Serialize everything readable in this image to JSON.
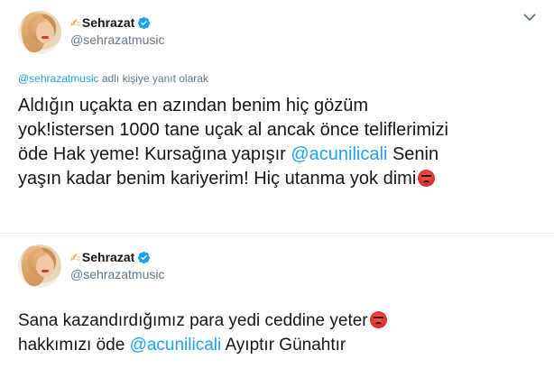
{
  "tweet1": {
    "display_name": "Sehrazat",
    "handle": "@sehrazatmusic",
    "reply_to": {
      "mention": "@sehrazatmusic",
      "suffix": " adlı kişiye yanıt olarak"
    },
    "text": {
      "line1": "Aldığın uçakta en azından benim hiç gözüm",
      "line2": "yok!istersen 1000 tane uçak al ancak önce teliflerimizi",
      "line3_a": "öde Hak yeme! Kursağına yapışır ",
      "line3_mention": "@acunilicali",
      "line3_b": " Senin",
      "line4": "yaşın kadar benim kariyerim! Hiç utanma yok dimi"
    }
  },
  "tweet2": {
    "display_name": "Sehrazat",
    "handle": "@sehrazatmusic",
    "text": {
      "line1": "Sana kazandırdığımız para yedi ceddine yeter",
      "line2_a": "hakkımızı öde ",
      "line2_mention": "@acunilicali",
      "line2_b": " Ayıptır Günahtır"
    }
  },
  "icons": {
    "verified": "verified-badge-icon",
    "pen": "writing-hand-icon",
    "angry": "angry-face-emoji",
    "caret": "chevron-down-icon"
  },
  "colors": {
    "link": "#1da1f2",
    "secondary": "#657786",
    "text": "#14171a"
  }
}
